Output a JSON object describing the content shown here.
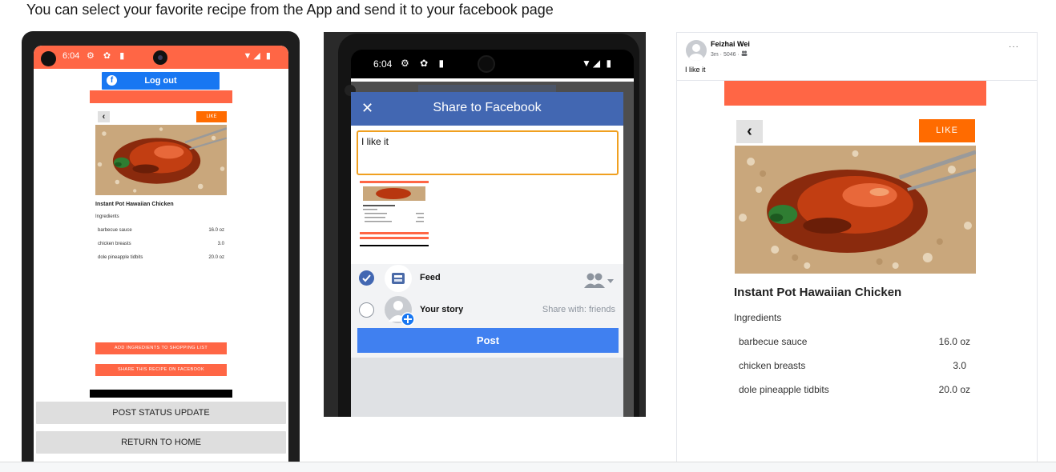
{
  "caption": "You can select your favorite recipe from the App and send it to your facebook page",
  "phone1": {
    "time": "6:04",
    "status_icons": "⚙ ✿ ▮",
    "right_icons": "▼◢ ▮",
    "fb_logout_label": "Log out",
    "like_label": "LIKE",
    "back_glyph": "‹",
    "recipe_title": "Instant Pot Hawaiian Chicken",
    "ingredients_label": "Ingredients",
    "ingredients": [
      {
        "name": "barbecue sauce",
        "amount": "16.0 oz"
      },
      {
        "name": "chicken breasts",
        "amount": "3.0"
      },
      {
        "name": "dole pineapple tidbits",
        "amount": "20.0 oz"
      }
    ],
    "add_to_list_label": "ADD INGREDIENTS TO SHOPPING LIST",
    "share_recipe_label": "SHARE THIS RECIPE ON FACEBOOK",
    "post_status_label": "POST STATUS UPDATE",
    "return_home_label": "RETURN TO HOME"
  },
  "phone2": {
    "time": "6:04",
    "status_icons": "⚙ ✿ ▮",
    "right_icons": "▼◢ ▮",
    "dialog_title": "Share to Facebook",
    "close_glyph": "✕",
    "message_value": "I like it",
    "feed_label": "Feed",
    "story_label": "Your story",
    "story_share_with": "Share with: friends",
    "post_label": "Post"
  },
  "fbpost": {
    "author": "Feizhai Wei",
    "meta": "3m · 5046 · ",
    "more_glyph": "···",
    "message": "I like it",
    "back_glyph": "‹",
    "like_label": "LIKE",
    "recipe_title": "Instant Pot Hawaiian Chicken",
    "ingredients_label": "Ingredients",
    "ingredients": [
      {
        "name": "barbecue sauce",
        "amount": "16.0 oz"
      },
      {
        "name": "chicken breasts",
        "amount": "3.0"
      },
      {
        "name": "dole pineapple tidbits",
        "amount": "20.0 oz"
      }
    ]
  },
  "colors": {
    "accent_orange": "#ff6645",
    "like_orange": "#ff6b00",
    "facebook_blue": "#1877f2",
    "dialog_header_blue": "#4267b2",
    "post_button_blue": "#4080f0"
  }
}
